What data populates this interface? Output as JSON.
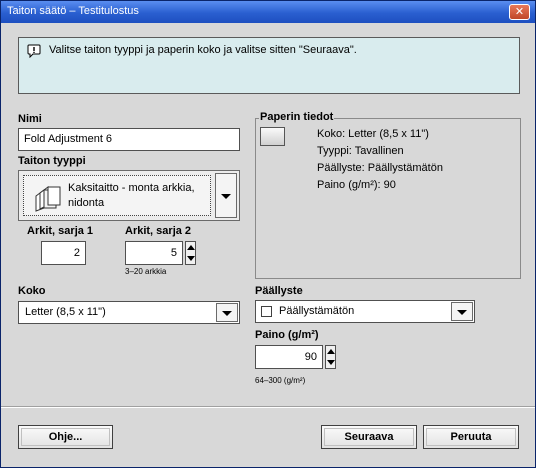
{
  "window": {
    "title": "Taiton säätö – Testitulostus",
    "close_label": "✕"
  },
  "message": {
    "text": "Valitse taiton tyyppi ja paperin koko ja valitse sitten \"Seuraava\"."
  },
  "name": {
    "label": "Nimi",
    "value": "Fold Adjustment 6"
  },
  "fold_type": {
    "label": "Taiton tyyppi",
    "value": "Kaksitaitto - monta arkkia, nidonta"
  },
  "sheets_set1": {
    "label": "Arkit, sarja 1",
    "value": "2"
  },
  "sheets_set2": {
    "label": "Arkit, sarja 2",
    "value": "5",
    "range_hint": "3–20 arkkia"
  },
  "size": {
    "label": "Koko",
    "value": "Letter (8,5 x 11\")"
  },
  "paper_info": {
    "legend": "Paperin tiedot",
    "size_line": "Koko: Letter (8,5 x 11\")",
    "type_line": "Tyyppi: Tavallinen",
    "coating_line": "Päällyste: Päällystämätön",
    "weight_line": "Paino (g/m²): 90"
  },
  "coating": {
    "label": "Päällyste",
    "value": "Päällystämätön"
  },
  "weight": {
    "label": "Paino (g/m²)",
    "value": "90",
    "range_hint": "64–300 (g/m²)"
  },
  "buttons": {
    "help": "Ohje...",
    "next": "Seuraava",
    "cancel": "Peruuta"
  },
  "colors": {
    "titlebar": "#2a5fd0",
    "message_bg": "#d9ecee",
    "window_bg": "#d8d8d8"
  }
}
